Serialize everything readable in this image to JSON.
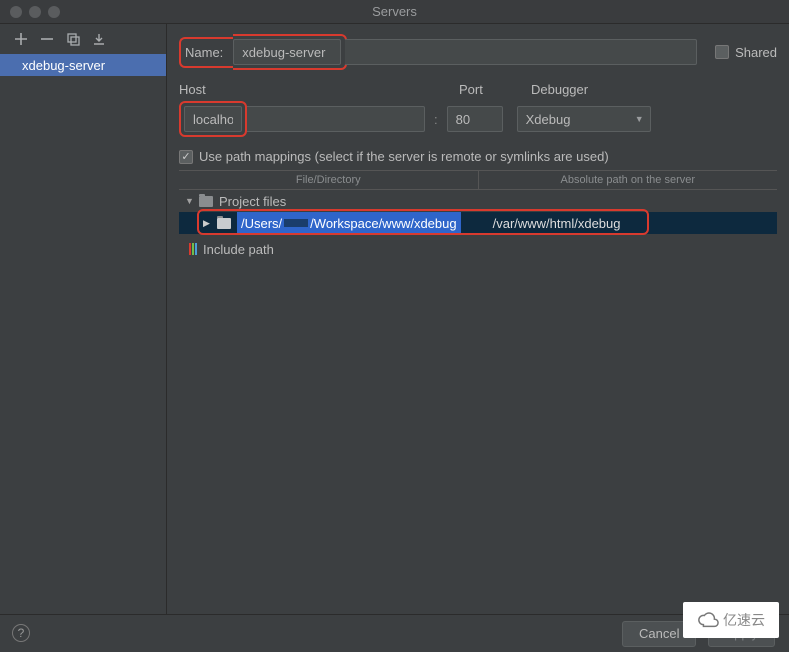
{
  "window": {
    "title": "Servers"
  },
  "sidebar": {
    "selected": "xdebug-server"
  },
  "form": {
    "name_label": "Name:",
    "name_value": "xdebug-server",
    "shared_label": "Shared",
    "host_label": "Host",
    "host_value": "localhost",
    "port_label": "Port",
    "port_value": "80",
    "debugger_label": "Debugger",
    "debugger_value": "Xdebug",
    "use_path_mappings_label": "Use path mappings (select if the server is remote or symlinks are used)",
    "col_file": "File/Directory",
    "col_server": "Absolute path on the server",
    "project_files_label": "Project files",
    "local_path_prefix": "/Users/",
    "local_path_suffix": " /Workspace/www/xdebug",
    "remote_path": "/var/www/html/xdebug",
    "include_path_label": "Include path"
  },
  "footer": {
    "cancel": "Cancel",
    "apply": "Apply"
  },
  "watermark": "亿速云"
}
